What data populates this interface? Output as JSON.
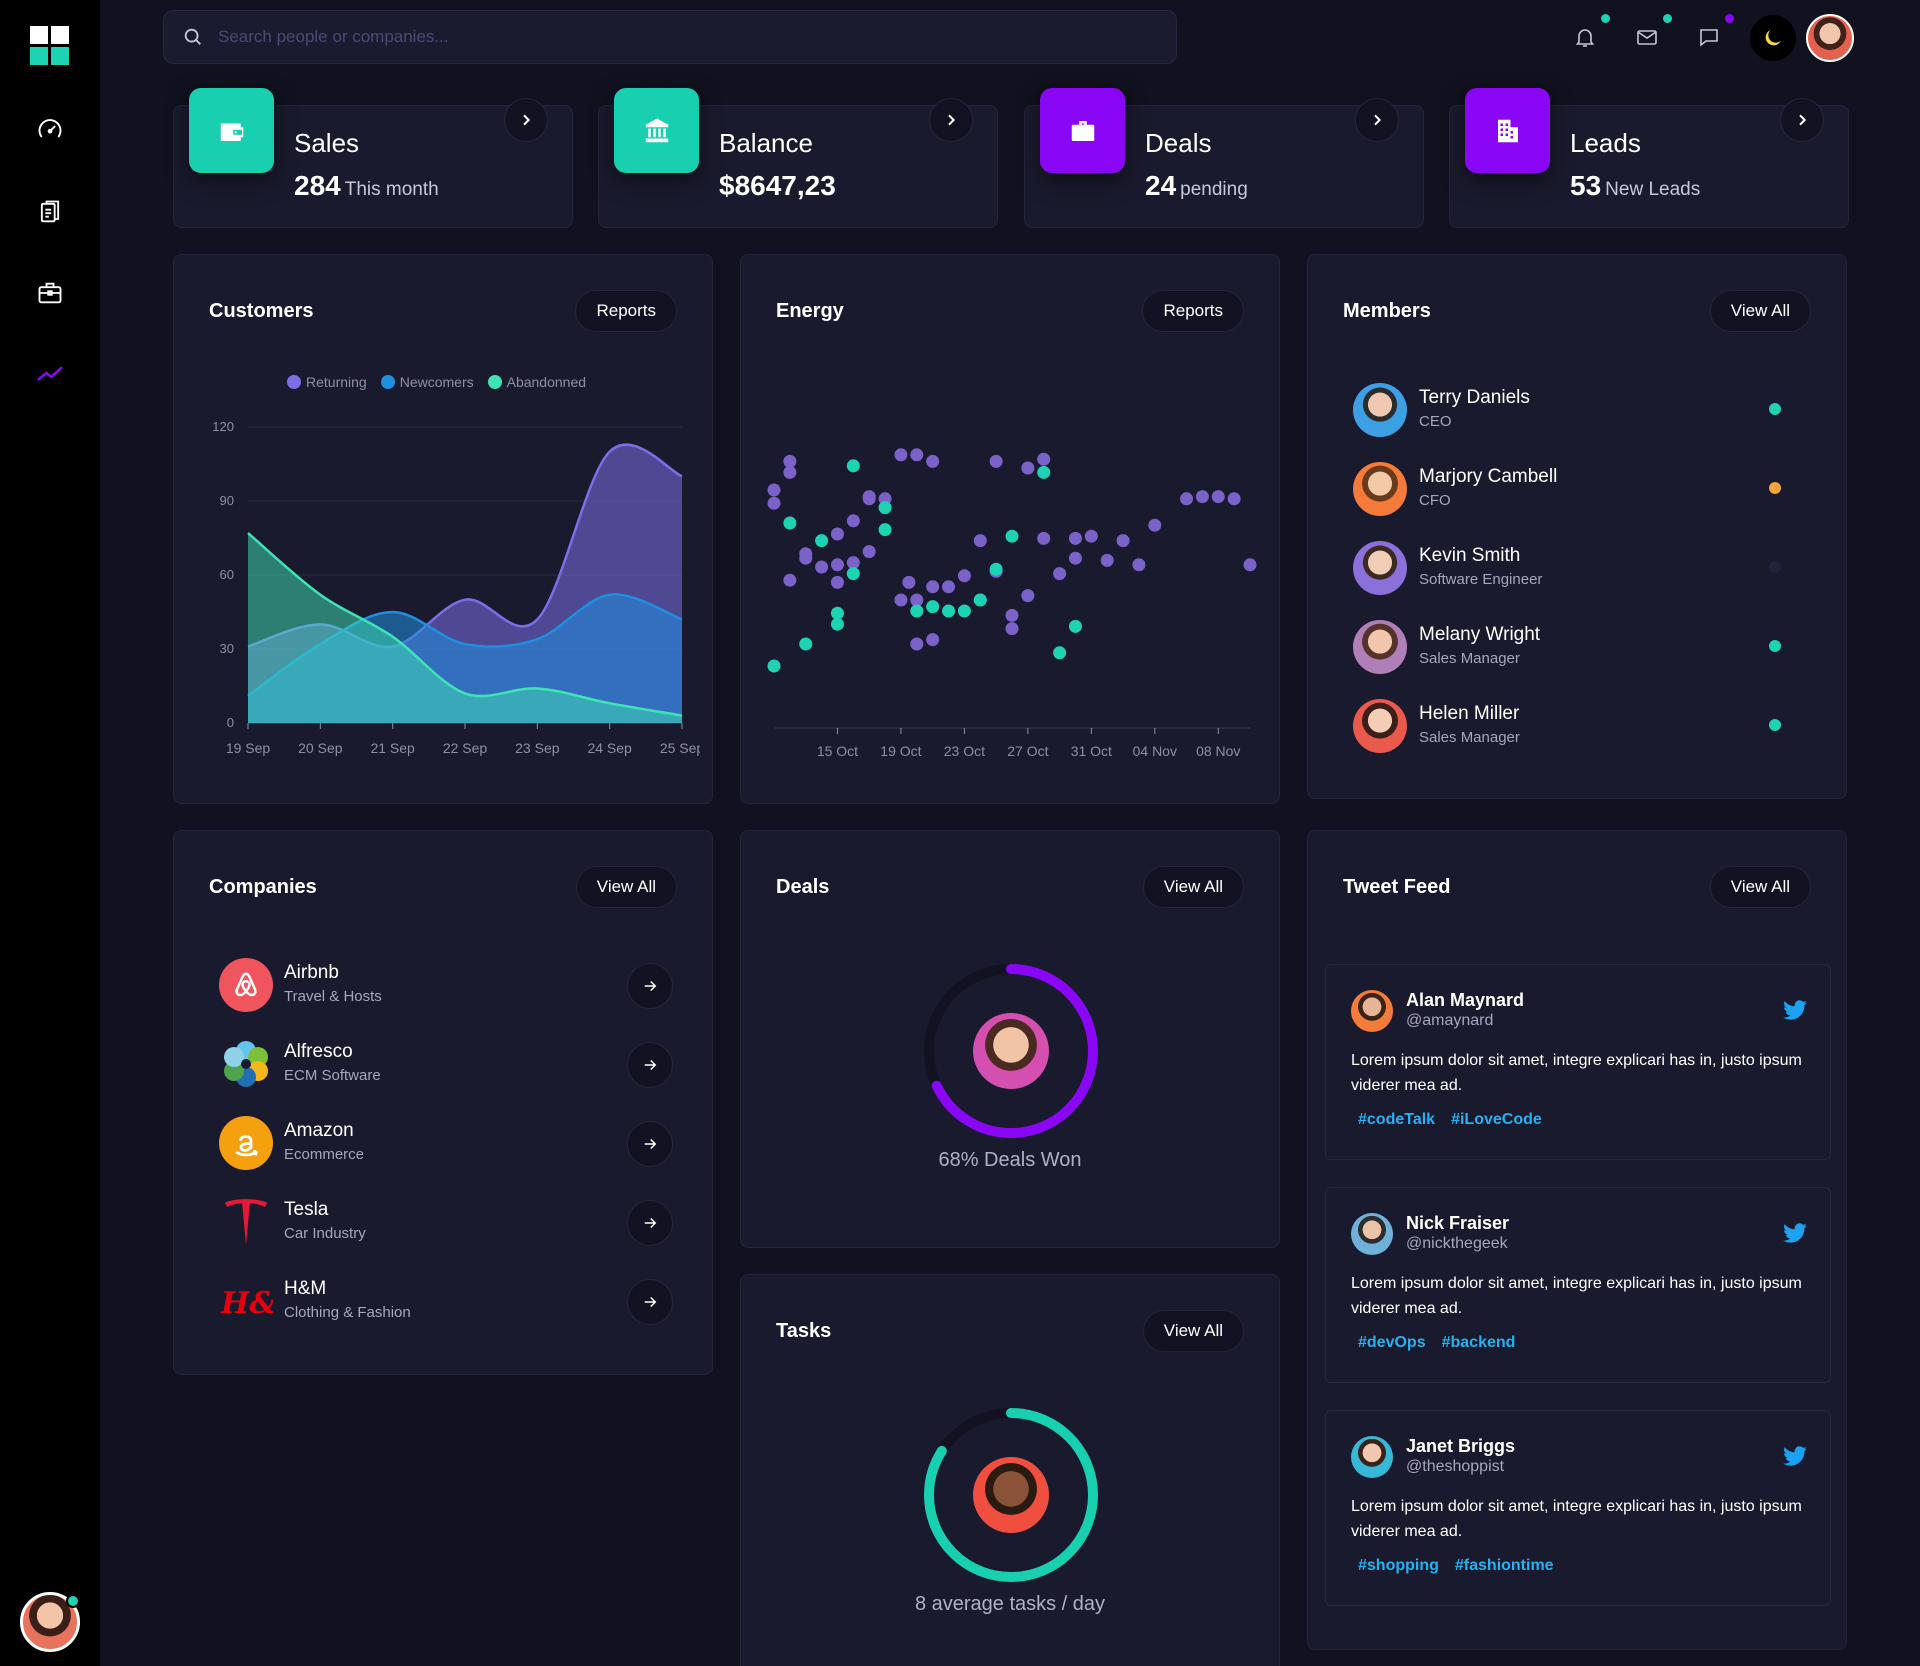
{
  "search": {
    "placeholder": "Search people or companies..."
  },
  "stats": [
    {
      "title": "Sales",
      "value": "284",
      "sub": "This month",
      "color": "#18cfb0",
      "icon": "wallet-icon"
    },
    {
      "title": "Balance",
      "value": "$8647,23",
      "sub": "",
      "color": "#18cfb0",
      "icon": "bank-icon"
    },
    {
      "title": "Deals",
      "value": "24",
      "sub": "pending",
      "color": "#8a07f5",
      "icon": "briefcase-icon"
    },
    {
      "title": "Leads",
      "value": "53",
      "sub": "New Leads",
      "color": "#8a07f5",
      "icon": "building-icon"
    }
  ],
  "customers": {
    "title": "Customers",
    "button": "Reports",
    "legend": [
      "Returning",
      "Newcomers",
      "Abandonned"
    ]
  },
  "energy": {
    "title": "Energy",
    "button": "Reports"
  },
  "members": {
    "title": "Members",
    "button": "View All",
    "items": [
      {
        "name": "Terry Daniels",
        "role": "CEO",
        "status": "#1ed3b4"
      },
      {
        "name": "Marjory Cambell",
        "role": "CFO",
        "status": "#f3a43b"
      },
      {
        "name": "Kevin Smith",
        "role": "Software Engineer",
        "status": "#22223a"
      },
      {
        "name": "Melany Wright",
        "role": "Sales Manager",
        "status": "#1ed3b4"
      },
      {
        "name": "Helen Miller",
        "role": "Sales Manager",
        "status": "#1ed3b4"
      }
    ]
  },
  "companies": {
    "title": "Companies",
    "button": "View All",
    "items": [
      {
        "name": "Airbnb",
        "type": "Travel & Hosts"
      },
      {
        "name": "Alfresco",
        "type": "ECM Software"
      },
      {
        "name": "Amazon",
        "type": "Ecommerce"
      },
      {
        "name": "Tesla",
        "type": "Car Industry"
      },
      {
        "name": "H&M",
        "type": "Clothing & Fashion"
      }
    ]
  },
  "deals": {
    "title": "Deals",
    "button": "View All",
    "label": "68% Deals Won",
    "percent": 68,
    "color": "#8a07f5"
  },
  "tasks": {
    "title": "Tasks",
    "button": "View All",
    "label": "8 average tasks / day",
    "percent": 84,
    "color": "#18cfb0"
  },
  "tweets": {
    "title": "Tweet Feed",
    "button": "View All",
    "items": [
      {
        "name": "Alan Maynard",
        "handle": "@amaynard",
        "text": "Lorem ipsum dolor sit amet, integre explicari has in, justo ipsum viderer mea ad.",
        "tags": [
          "#codeTalk",
          "#iLoveCode"
        ]
      },
      {
        "name": "Nick Fraiser",
        "handle": "@nickthegeek",
        "text": "Lorem ipsum dolor sit amet, integre explicari has in, justo ipsum viderer mea ad.",
        "tags": [
          "#devOps",
          "#backend"
        ]
      },
      {
        "name": "Janet Briggs",
        "handle": "@theshoppist",
        "text": "Lorem ipsum dolor sit amet, integre explicari has in, justo ipsum viderer mea ad.",
        "tags": [
          "#shopping",
          "#fashiontime"
        ]
      }
    ]
  },
  "chart_data": [
    {
      "type": "area",
      "categories": [
        "19 Sep",
        "20 Sep",
        "21 Sep",
        "22 Sep",
        "23 Sep",
        "24 Sep",
        "25 Sep"
      ],
      "ylim": [
        0,
        120
      ],
      "yticks": [
        0,
        30,
        60,
        90,
        120
      ],
      "series": [
        {
          "name": "Returning",
          "color": "#7b6fe8",
          "values": [
            31,
            40,
            31,
            50,
            42,
            110,
            100
          ]
        },
        {
          "name": "Newcomers",
          "color": "#1f8fe0",
          "values": [
            11,
            32,
            45,
            32,
            34,
            52,
            42
          ]
        },
        {
          "name": "Abandonned",
          "color": "#3ee3b6",
          "values": [
            77,
            52,
            35,
            12,
            14,
            8,
            3
          ]
        }
      ]
    },
    {
      "type": "scatter",
      "xticks": [
        "15 Oct",
        "19 Oct",
        "23 Oct",
        "27 Oct",
        "31 Oct",
        "04 Nov",
        "08 Nov"
      ],
      "xlim": [
        11,
        41
      ],
      "ylim": [
        0,
        100
      ],
      "series": [
        {
          "name": "",
          "color": "#7b62c9",
          "x": [
            11.0,
            12.0,
            15.0,
            18.0,
            19.0,
            20.0,
            21.0,
            25.0,
            27.0,
            28.0,
            17.0,
            17.0,
            16.0,
            24.0,
            28.0,
            31.0,
            30.0,
            35.0,
            38.0,
            11.0,
            12.0,
            12.0,
            13.0,
            13.0,
            14.0,
            15.0,
            16.0,
            15.0,
            17.0,
            19.0,
            20.0,
            21.0,
            22.0,
            23.0,
            24.0,
            25.0,
            27.0,
            29.0,
            32.0,
            33.0,
            34.0,
            37.0,
            39.0,
            40.0,
            41.0,
            20.0,
            21.0,
            26.0,
            30.0,
            26.0,
            19.5
          ],
          "y": [
            90,
            98,
            70,
            86,
            106,
            106,
            103,
            103,
            100,
            104,
            86,
            87,
            76,
            67,
            68,
            69,
            68,
            74,
            87,
            84,
            103,
            49,
            59,
            61,
            55,
            56,
            57,
            48,
            62,
            40,
            40,
            46,
            46,
            51,
            40,
            53,
            42,
            52,
            58,
            67,
            56,
            86,
            87,
            86,
            56,
            20,
            22,
            27,
            59,
            33,
            48
          ]
        },
        {
          "name": "",
          "color": "#1ed3b4",
          "x": [
            11.0,
            12.0,
            16.0,
            18.0,
            18.0,
            14.0,
            15.0,
            16.0,
            15.0,
            20.0,
            21.0,
            22.0,
            23.0,
            24.0,
            25.0,
            26.0,
            28.0,
            30.0,
            29.0,
            13.0
          ],
          "y": [
            10,
            75,
            101,
            82,
            72,
            67,
            34,
            52,
            29,
            35,
            37,
            35,
            35,
            40,
            54,
            69,
            98,
            28,
            16,
            20
          ]
        }
      ]
    }
  ],
  "colors": {
    "background": "#11111f",
    "panel": "#1a1a2e",
    "teal": "#18cfb0",
    "purple": "#8a07f5",
    "link": "#27b1f0"
  }
}
